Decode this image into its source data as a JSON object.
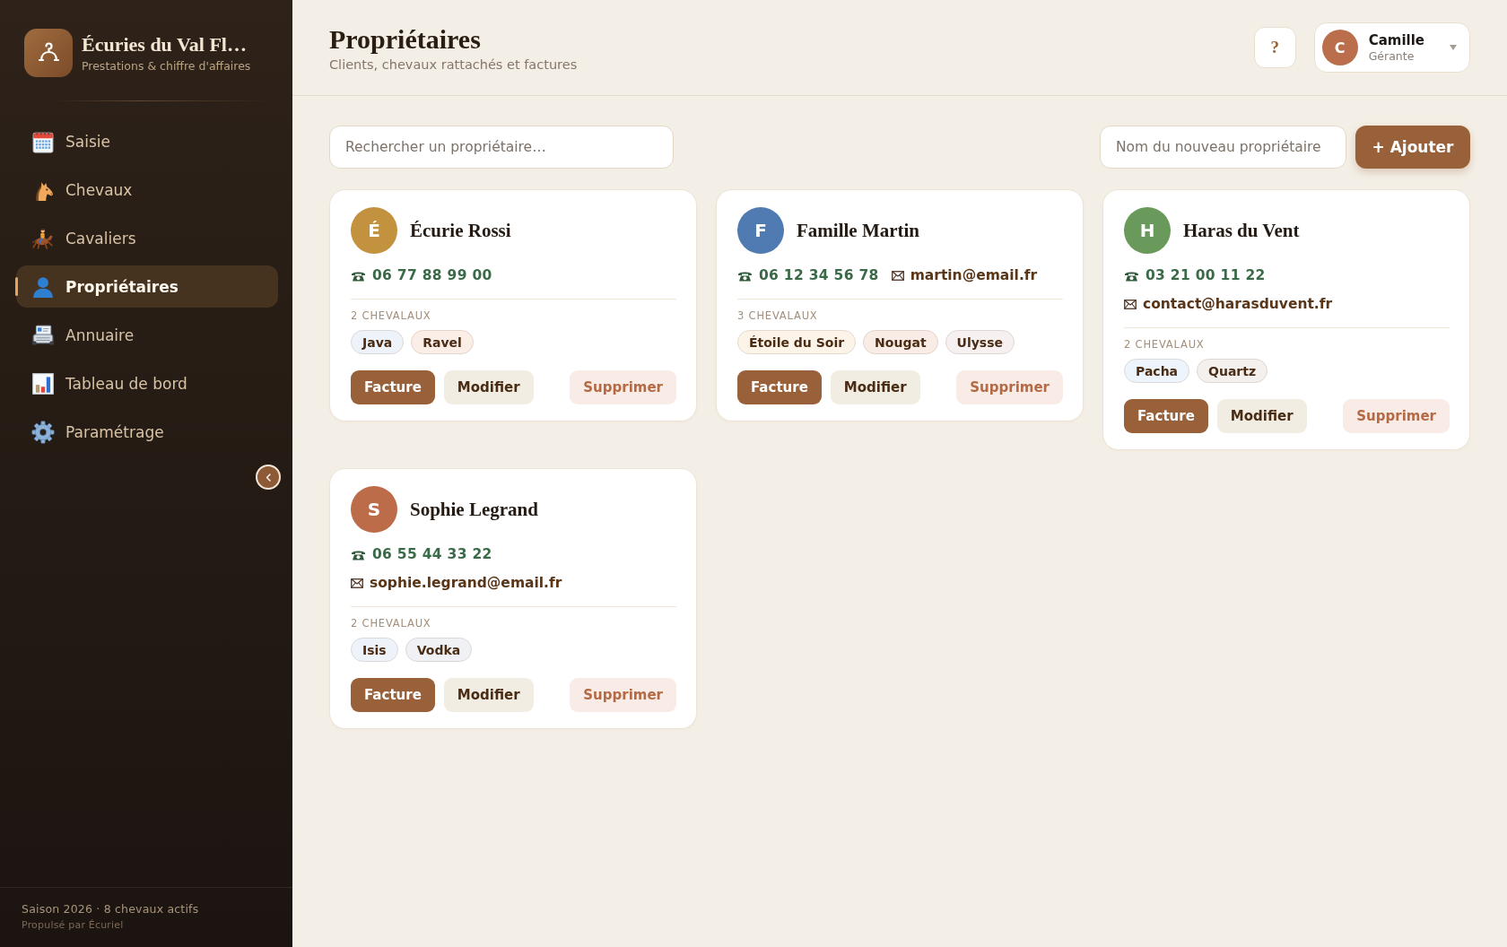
{
  "sidebar": {
    "brand": {
      "title": "Écuries du Val Fl…",
      "subtitle": "Prestations & chiffre d'affaires"
    },
    "nav": [
      {
        "label": "Saisie",
        "selected": false
      },
      {
        "label": "Chevaux",
        "selected": false
      },
      {
        "label": "Cavaliers",
        "selected": false
      },
      {
        "label": "Propriétaires",
        "selected": true
      },
      {
        "label": "Annuaire",
        "selected": false
      },
      {
        "label": "Tableau de bord",
        "selected": false
      },
      {
        "label": "Paramétrage",
        "selected": false
      }
    ],
    "footer": {
      "season": "Saison 2026 · 8 chevaux actifs",
      "credit": "Propulsé par Écuriel"
    }
  },
  "header": {
    "title": "Propriétaires",
    "subtitle": "Clients, chevaux rattachés et factures",
    "help": "?",
    "user": {
      "initial": "C",
      "name": "Camille",
      "role": "Gérante",
      "color": "#bb6e4c"
    }
  },
  "toolbar": {
    "search": {
      "placeholder": "Rechercher un propriétaire…"
    },
    "new_owner": {
      "placeholder": "Nom du nouveau propriétaire"
    },
    "add_button": "+ Ajouter"
  },
  "owners": [
    {
      "initial": "É",
      "name": "Écurie Rossi",
      "color": "#c3923f",
      "phone": "06 77 88 99 00",
      "horses_label": "2 CHEVALAUX",
      "horses": [
        {
          "name": "Java",
          "color": "#eef3f9"
        },
        {
          "name": "Ravel",
          "color": "#faeee7"
        }
      ],
      "actions": [
        {
          "label": "Facture",
          "kind": "primary"
        },
        {
          "label": "Modifier",
          "kind": "secondary"
        },
        {
          "label": "Supprimer",
          "kind": "danger"
        }
      ]
    },
    {
      "initial": "F",
      "name": "Famille Martin",
      "color": "#4f7bb2",
      "phone": "06 12 34 56 78",
      "email": "martin@email.fr",
      "horses_label": "3 CHEVALAUX",
      "horses": [
        {
          "name": "Étoile du Soir",
          "color": "#fcf4e8"
        },
        {
          "name": "Nougat",
          "color": "#f9ece6"
        },
        {
          "name": "Ulysse",
          "color": "#f6f0f1"
        }
      ],
      "actions": [
        {
          "label": "Facture",
          "kind": "primary"
        },
        {
          "label": "Modifier",
          "kind": "secondary"
        },
        {
          "label": "Supprimer",
          "kind": "danger"
        }
      ]
    },
    {
      "initial": "H",
      "name": "Haras du Vent",
      "color": "#6a9a5b",
      "phone": "03 21 00 11 22",
      "email": "contact@harasduvent.fr",
      "horses_label": "2 CHEVALAUX",
      "horses": [
        {
          "name": "Pacha",
          "color": "#edf4fb"
        },
        {
          "name": "Quartz",
          "color": "#f3f0ee"
        }
      ],
      "actions": [
        {
          "label": "Facture",
          "kind": "primary"
        },
        {
          "label": "Modifier",
          "kind": "secondary"
        },
        {
          "label": "Supprimer",
          "kind": "danger"
        }
      ]
    },
    {
      "initial": "S",
      "name": "Sophie Legrand",
      "color": "#bd6c49",
      "phone": "06 55 44 33 22",
      "email": "sophie.legrand@email.fr",
      "horses_label": "2 CHEVALAUX",
      "horses": [
        {
          "name": "Isis",
          "color": "#eef3f9"
        },
        {
          "name": "Vodka",
          "color": "#eff1f5"
        }
      ],
      "actions": [
        {
          "label": "Facture",
          "kind": "primary"
        },
        {
          "label": "Modifier",
          "kind": "secondary"
        },
        {
          "label": "Supprimer",
          "kind": "danger"
        }
      ]
    }
  ]
}
